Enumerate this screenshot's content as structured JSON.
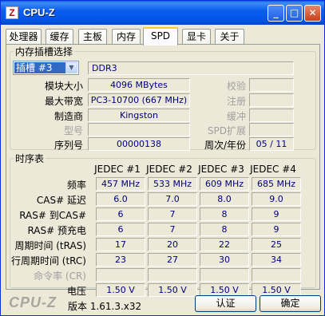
{
  "window": {
    "title": "CPU-Z",
    "icon": "Z",
    "min": "_",
    "max": "□",
    "close": "✕"
  },
  "tabs": [
    "处理器",
    "缓存",
    "主板",
    "内存",
    "SPD",
    "显卡",
    "关于"
  ],
  "active_tab": "SPD",
  "slot": {
    "legend": "内存插槽选择",
    "selected": "插槽 #3",
    "type": "DDR3",
    "module_size_label": "模块大小",
    "module_size": "4096 MBytes",
    "max_bw_label": "最大带宽",
    "max_bw": "PC3-10700 (667 MHz)",
    "manufacturer_label": "制造商",
    "manufacturer": "Kingston",
    "part_label": "型号",
    "part": "",
    "serial_label": "序列号",
    "serial": "00000138",
    "check_label": "校验",
    "check": "",
    "reg_label": "注册",
    "reg": "",
    "buffer_label": "缓冲",
    "buffer": "",
    "spd_ext_label": "SPD扩展",
    "spd_ext": "",
    "week_year_label": "周次/年份",
    "week_year": "05 / 11"
  },
  "timings": {
    "legend": "时序表",
    "columns": [
      "JEDEC #1",
      "JEDEC #2",
      "JEDEC #3",
      "JEDEC #4"
    ],
    "rows": [
      {
        "label": "频率",
        "values": [
          "457 MHz",
          "533 MHz",
          "609 MHz",
          "685 MHz"
        ]
      },
      {
        "label": "CAS# 延迟",
        "values": [
          "6.0",
          "7.0",
          "8.0",
          "9.0"
        ]
      },
      {
        "label": "RAS# 到CAS#",
        "values": [
          "6",
          "7",
          "8",
          "9"
        ]
      },
      {
        "label": "RAS# 预充电",
        "values": [
          "6",
          "7",
          "8",
          "9"
        ]
      },
      {
        "label": "周期时间 (tRAS)",
        "values": [
          "17",
          "20",
          "22",
          "25"
        ]
      },
      {
        "label": "行周期时间 (tRC)",
        "values": [
          "23",
          "27",
          "30",
          "34"
        ]
      },
      {
        "label": "命令率 (CR)",
        "values": [
          "",
          "",
          "",
          ""
        ],
        "dim": true
      },
      {
        "label": "电压",
        "values": [
          "1.50 V",
          "1.50 V",
          "1.50 V",
          "1.50 V"
        ]
      }
    ]
  },
  "footer": {
    "brand": "CPU-Z",
    "version": "版本 1.61.3.x32",
    "validate": "认证",
    "ok": "确定"
  }
}
